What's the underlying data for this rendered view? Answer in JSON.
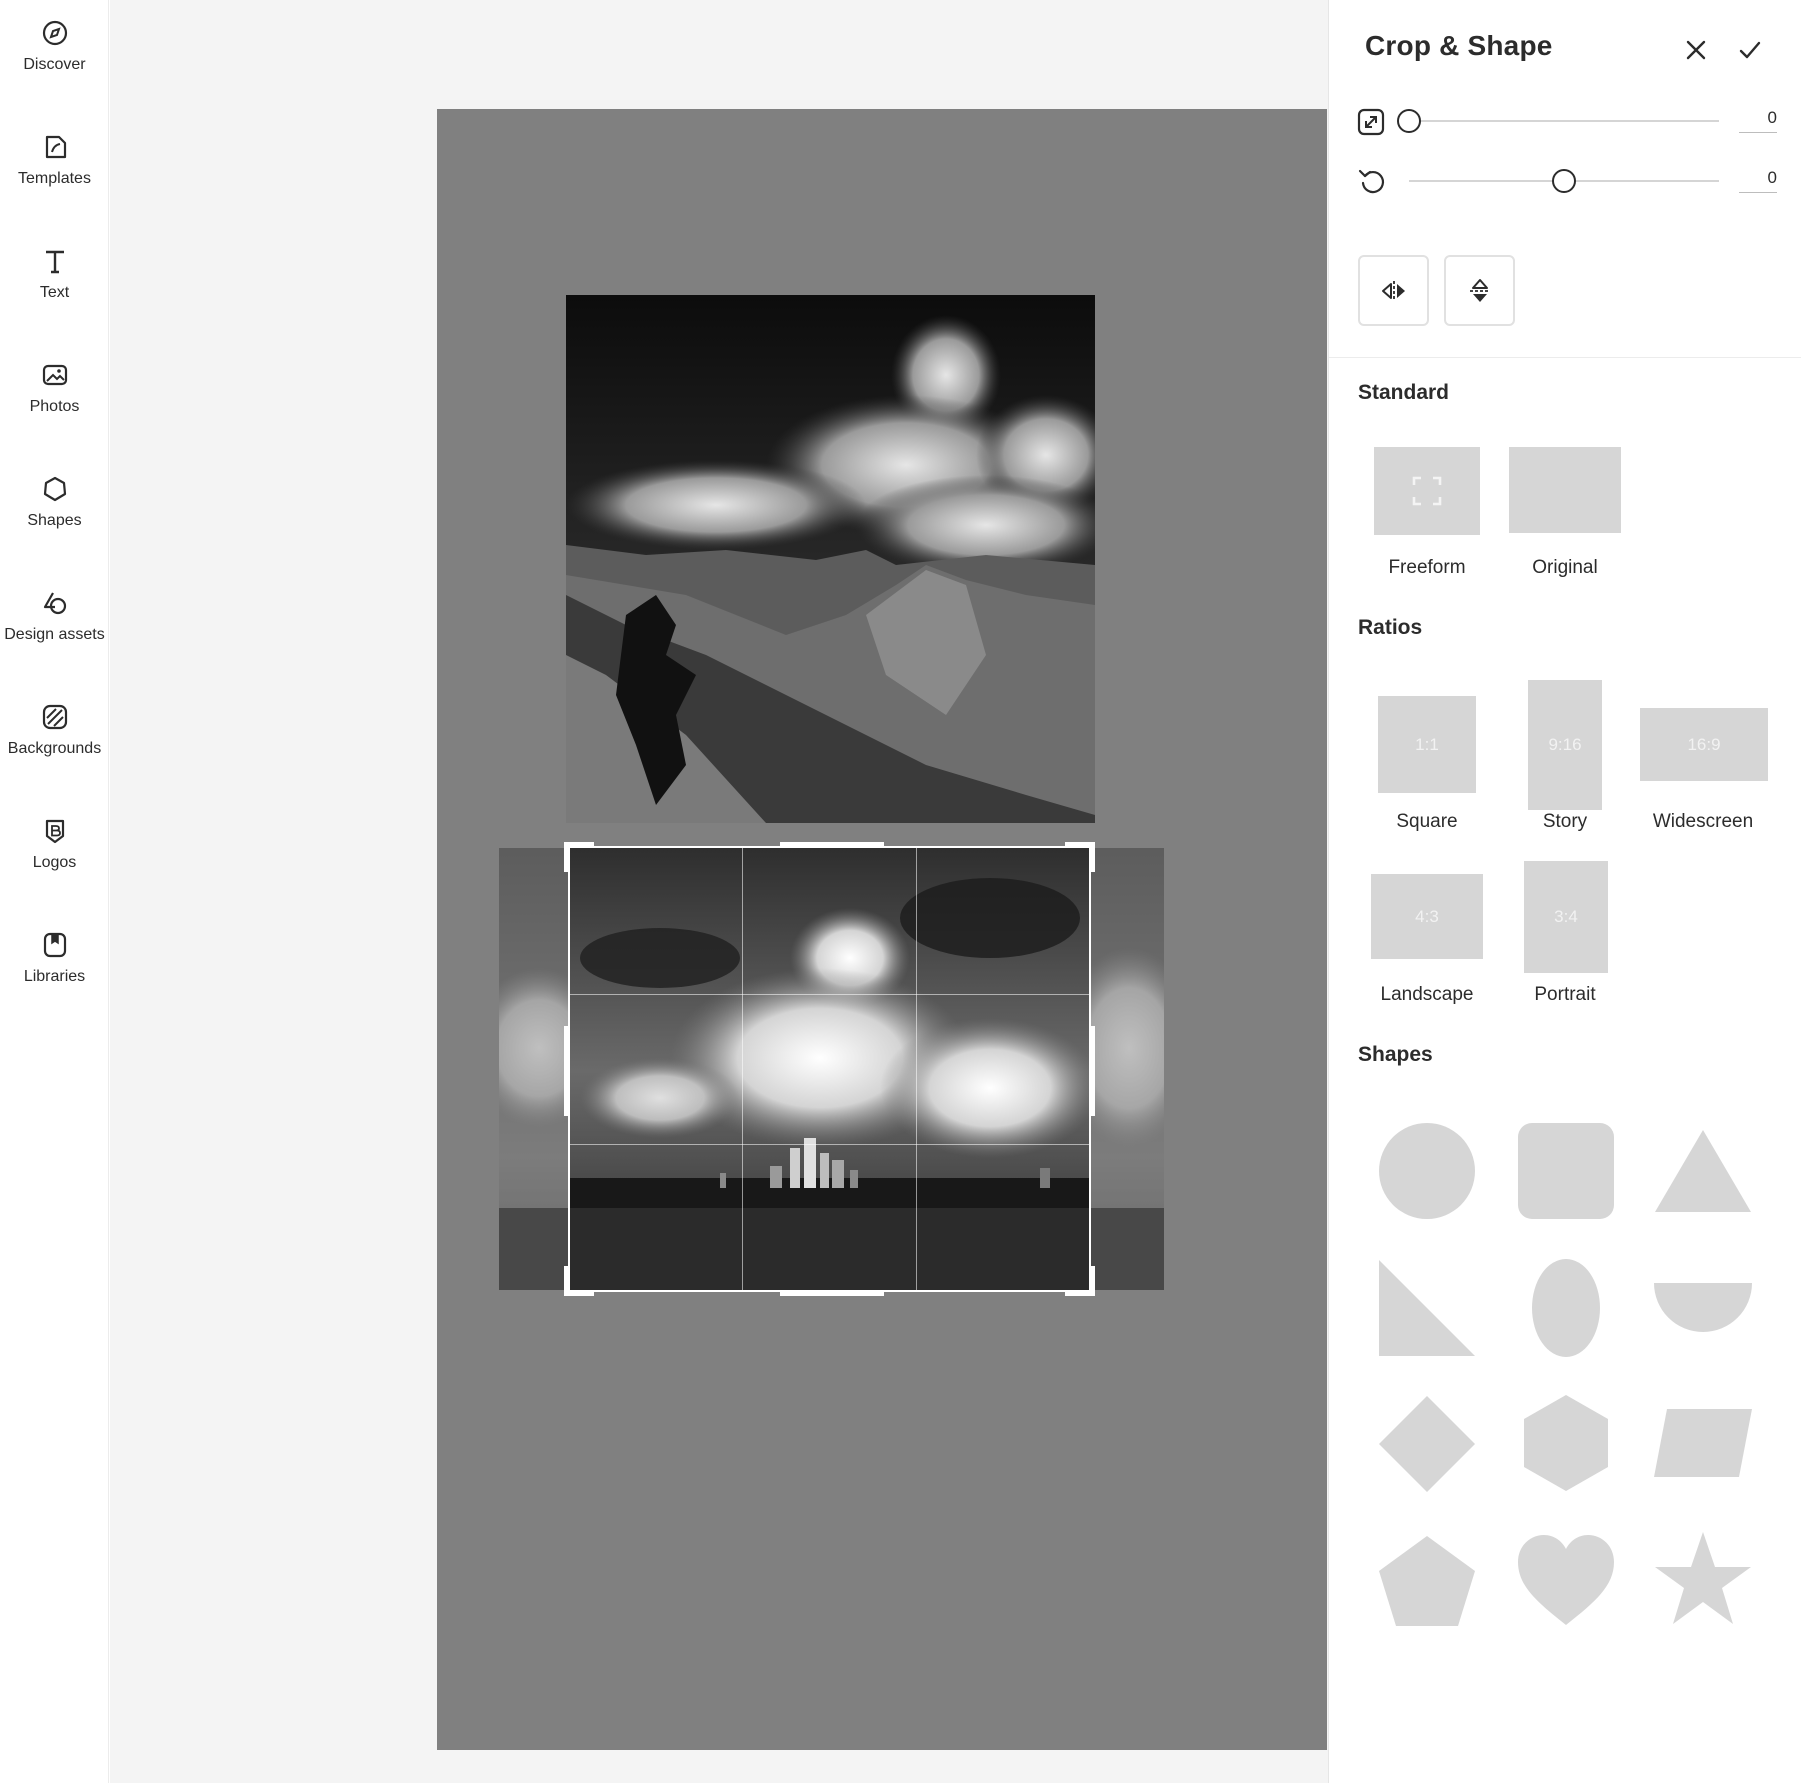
{
  "sidebar": {
    "items": [
      {
        "label": "Discover",
        "icon": "discover-icon"
      },
      {
        "label": "Templates",
        "icon": "templates-icon"
      },
      {
        "label": "Text",
        "icon": "text-icon"
      },
      {
        "label": "Photos",
        "icon": "photos-icon"
      },
      {
        "label": "Shapes",
        "icon": "shapes-icon"
      },
      {
        "label": "Design assets",
        "icon": "design-assets-icon"
      },
      {
        "label": "Backgrounds",
        "icon": "backgrounds-icon"
      },
      {
        "label": "Logos",
        "icon": "logos-icon"
      },
      {
        "label": "Libraries",
        "icon": "libraries-icon"
      }
    ]
  },
  "panel": {
    "title": "Crop & Shape",
    "zoom_value": "0",
    "rotate_value": "0",
    "zoom_level": 0,
    "rotate_level": 0.5,
    "standard": {
      "title": "Standard",
      "items": [
        {
          "label": "Freeform"
        },
        {
          "label": "Original"
        }
      ]
    },
    "ratios": {
      "title": "Ratios",
      "items": [
        {
          "ratio": "1:1",
          "label": "Square"
        },
        {
          "ratio": "9:16",
          "label": "Story"
        },
        {
          "ratio": "16:9",
          "label": "Widescreen"
        },
        {
          "ratio": "4:3",
          "label": "Landscape"
        },
        {
          "ratio": "3:4",
          "label": "Portrait"
        }
      ]
    },
    "shapes": {
      "title": "Shapes"
    }
  },
  "colors": {
    "accent": "#2c2c2c",
    "tile": "#d6d6d6",
    "artboard": "#808080",
    "workspace": "#f4f4f4"
  }
}
